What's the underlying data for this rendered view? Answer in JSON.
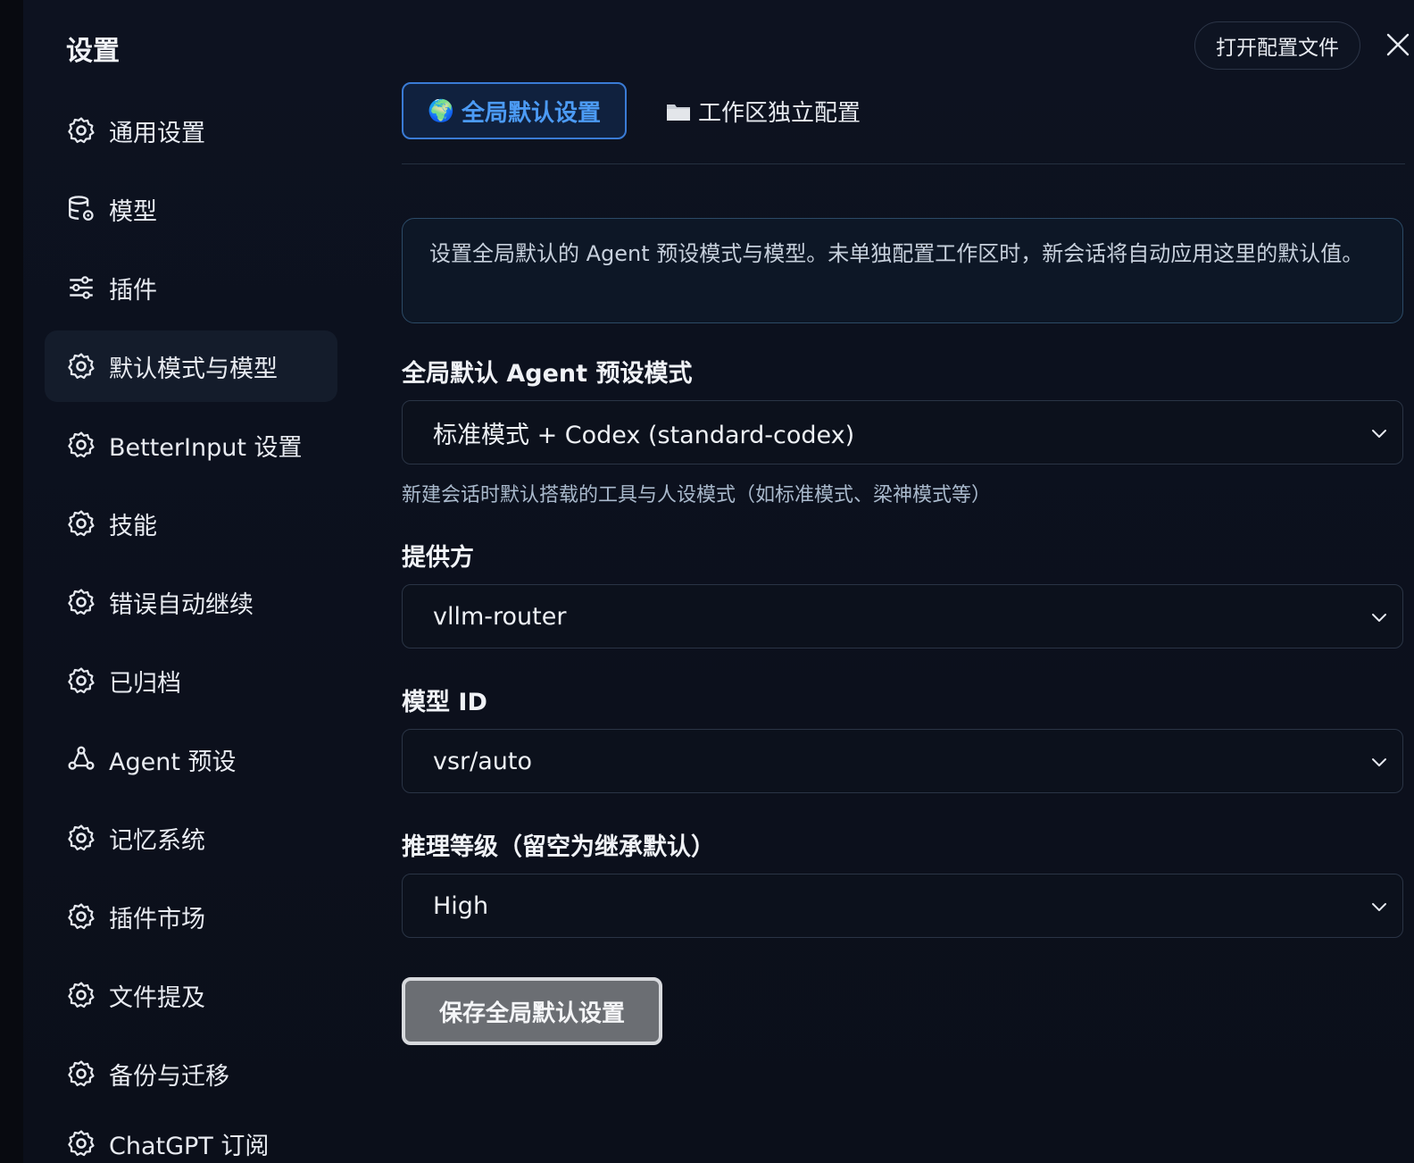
{
  "header": {
    "title": "设置",
    "open_config_label": "打开配置文件"
  },
  "sidebar": {
    "items": [
      {
        "label": "通用设置",
        "icon": "gear-icon"
      },
      {
        "label": "模型",
        "icon": "database-gear-icon"
      },
      {
        "label": "插件",
        "icon": "sliders-icon"
      },
      {
        "label": "默认模式与模型",
        "icon": "gear-icon",
        "active": true
      },
      {
        "label": "BetterInput 设置",
        "icon": "gear-icon"
      },
      {
        "label": "技能",
        "icon": "gear-icon"
      },
      {
        "label": "错误自动继续",
        "icon": "gear-icon"
      },
      {
        "label": "已归档",
        "icon": "gear-icon"
      },
      {
        "label": "Agent 预设",
        "icon": "robot-icon"
      },
      {
        "label": "记忆系统",
        "icon": "gear-icon"
      },
      {
        "label": "插件市场",
        "icon": "gear-icon"
      },
      {
        "label": "文件提及",
        "icon": "gear-icon"
      },
      {
        "label": "备份与迁移",
        "icon": "gear-icon"
      },
      {
        "label": "ChatGPT 订阅",
        "icon": "gear-icon"
      }
    ]
  },
  "tabs": {
    "global_icon": "🌍",
    "global_label": "全局默认设置",
    "workspace_label": "工作区独立配置"
  },
  "info": {
    "text": "设置全局默认的 Agent 预设模式与模型。未单独配置工作区时，新会话将自动应用这里的默认值。"
  },
  "form": {
    "preset_label": "全局默认 Agent 预设模式",
    "preset_value": "标准模式 + Codex (standard-codex)",
    "preset_hint": "新建会话时默认搭载的工具与人设模式（如标准模式、梁神模式等）",
    "provider_label": "提供方",
    "provider_value": "vllm-router",
    "model_label": "模型 ID",
    "model_value": "vsr/auto",
    "reasoning_label": "推理等级（留空为继承默认）",
    "reasoning_value": "High",
    "save_label": "保存全局默认设置"
  },
  "colors": {
    "accent": "#3a7bd5",
    "background": "#0b0f1a",
    "active_nav": "#141c2b"
  }
}
